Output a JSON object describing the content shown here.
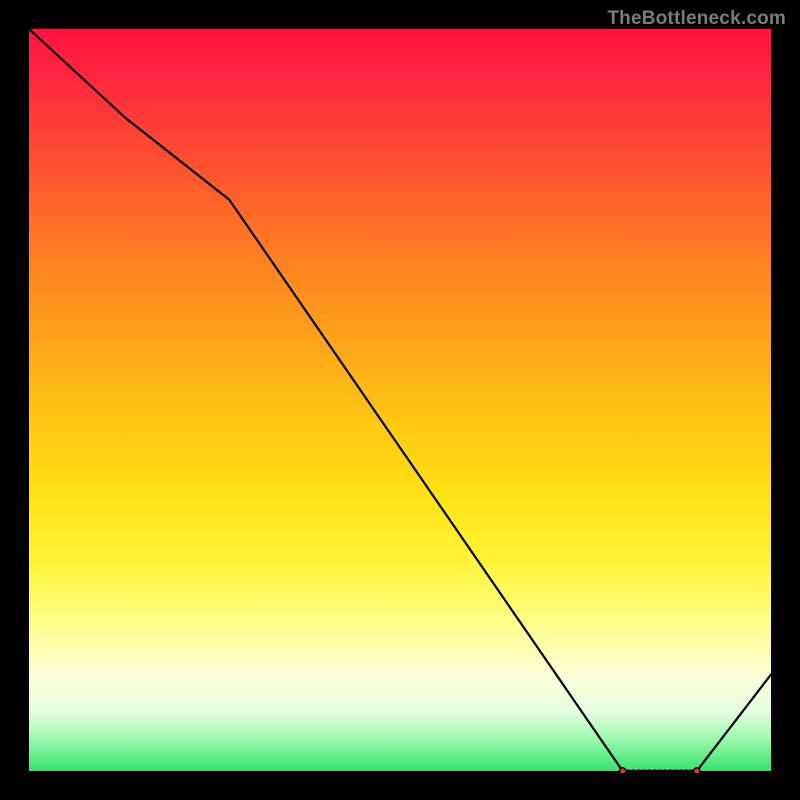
{
  "watermark": "TheBottleneck.com",
  "chart_data": {
    "type": "line",
    "title": "",
    "xlabel": "",
    "ylabel": "",
    "xlim": [
      0,
      100
    ],
    "ylim": [
      0,
      100
    ],
    "curve": {
      "name": "bottleneck-curve",
      "x": [
        0,
        13,
        27,
        80,
        90,
        100
      ],
      "y": [
        100,
        88,
        77,
        0,
        0,
        13
      ]
    },
    "flat_region": {
      "x_start": 80,
      "x_end": 90,
      "y": 0,
      "label": "",
      "endpoint_marker_radius": 3.2,
      "tick_count": 14
    },
    "gradient_stops": [
      {
        "pos": 0.0,
        "color": "#ff143f"
      },
      {
        "pos": 0.3,
        "color": "#ff7c24"
      },
      {
        "pos": 0.63,
        "color": "#ffe215"
      },
      {
        "pos": 0.87,
        "color": "#fdffd7"
      },
      {
        "pos": 1.0,
        "color": "#36e26f"
      }
    ]
  }
}
